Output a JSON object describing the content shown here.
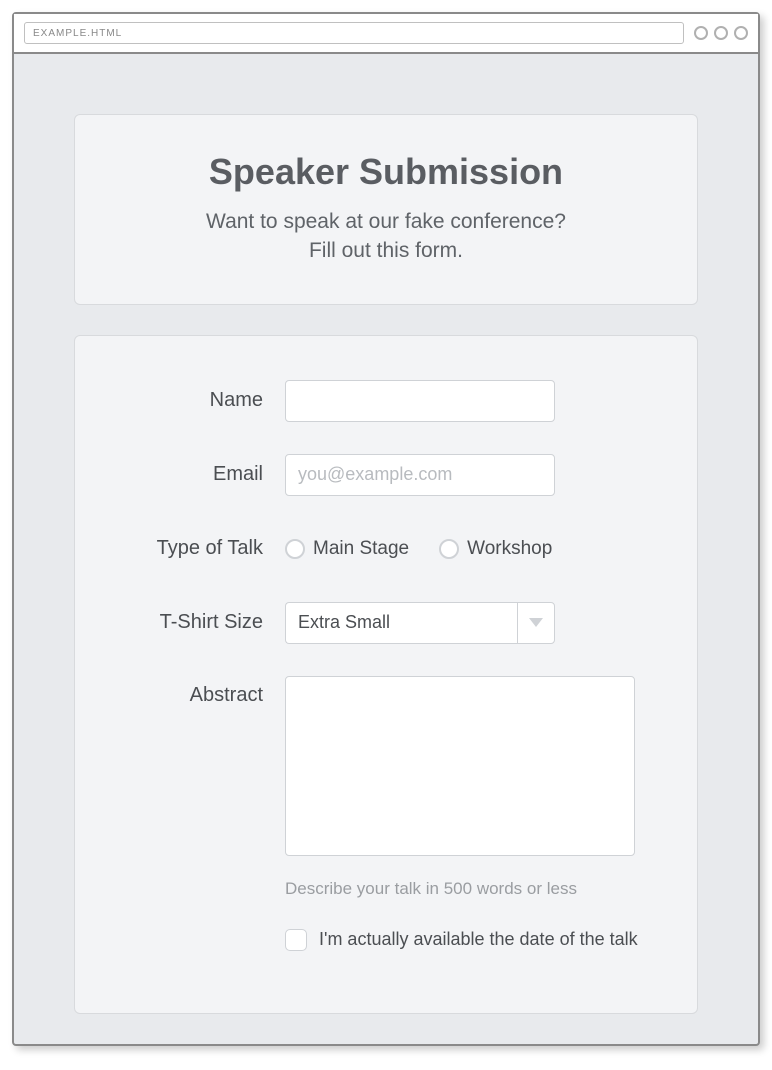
{
  "window": {
    "url": "EXAMPLE.HTML"
  },
  "header": {
    "title": "Speaker Submission",
    "subtitle_line1": "Want to speak at our fake conference?",
    "subtitle_line2": "Fill out this form."
  },
  "form": {
    "name": {
      "label": "Name",
      "value": ""
    },
    "email": {
      "label": "Email",
      "placeholder": "you@example.com",
      "value": ""
    },
    "talk_type": {
      "label": "Type of Talk",
      "options": [
        "Main Stage",
        "Workshop"
      ],
      "selected": null
    },
    "tshirt": {
      "label": "T-Shirt Size",
      "selected": "Extra Small"
    },
    "abstract": {
      "label": "Abstract",
      "value": "",
      "hint": "Describe your talk in 500 words or less"
    },
    "availability": {
      "label": "I'm actually available the date of the talk",
      "checked": false
    }
  }
}
